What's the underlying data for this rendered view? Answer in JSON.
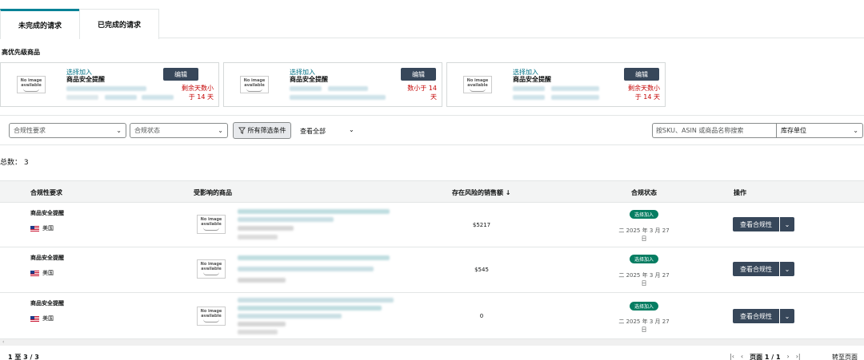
{
  "tabs": [
    {
      "label": "未完成的请求",
      "active": true
    },
    {
      "label": "已完成的请求",
      "active": false
    }
  ],
  "priority": {
    "title": "高优先级商品",
    "cards": [
      {
        "thumb": "No image available",
        "link": "选择加入",
        "name": "商品安全提醒",
        "edit": "编辑",
        "remaining": "剩余天数小于 14 天"
      },
      {
        "thumb": "No image available",
        "link": "选择加入",
        "name": "商品安全提醒",
        "edit": "编辑",
        "remaining": "数小于 14 天"
      },
      {
        "thumb": "No image available",
        "link": "选择加入",
        "name": "商品安全提醒",
        "edit": "编辑",
        "remaining": "剩余天数小于 14 天"
      }
    ]
  },
  "filters": {
    "compliance_req": "合规性要求",
    "compliance_status": "合规状态",
    "all_filters": "所有筛选条件",
    "view_all": "查看全部",
    "search_placeholder": "按SKU、ASIN 或商品名称搜索",
    "unit": "库存单位"
  },
  "total": "总数： 3",
  "table": {
    "headers": [
      "合规性要求",
      "受影响的商品",
      "存在风险的销售额 ↓",
      "合规状态",
      "操作"
    ],
    "rows": [
      {
        "requirement": "商品安全提醒",
        "marketplace": "美国",
        "thumb": "No image available",
        "sales": "$5217",
        "status": "选择加入",
        "date": "二 2025 年 3 月 27 日",
        "action": "查看合规性"
      },
      {
        "requirement": "商品安全提醒",
        "marketplace": "美国",
        "thumb": "No image available",
        "sales": "$545",
        "status": "选择加入",
        "date": "二 2025 年 3 月 27 日",
        "action": "查看合规性"
      },
      {
        "requirement": "商品安全提醒",
        "marketplace": "美国",
        "thumb": "No image available",
        "sales": "0",
        "status": "选择加入",
        "date": "二 2025 年 3 月 27 日",
        "action": "查看合规性"
      }
    ]
  },
  "footer": {
    "count": "1 至 3 / 3",
    "page": "页面 1 / 1",
    "goto": "转至页面"
  },
  "colors": {
    "accent": "#008296",
    "dark_button": "#37475a",
    "warning": "#c40000",
    "badge": "#067d62",
    "link": "#007185"
  }
}
